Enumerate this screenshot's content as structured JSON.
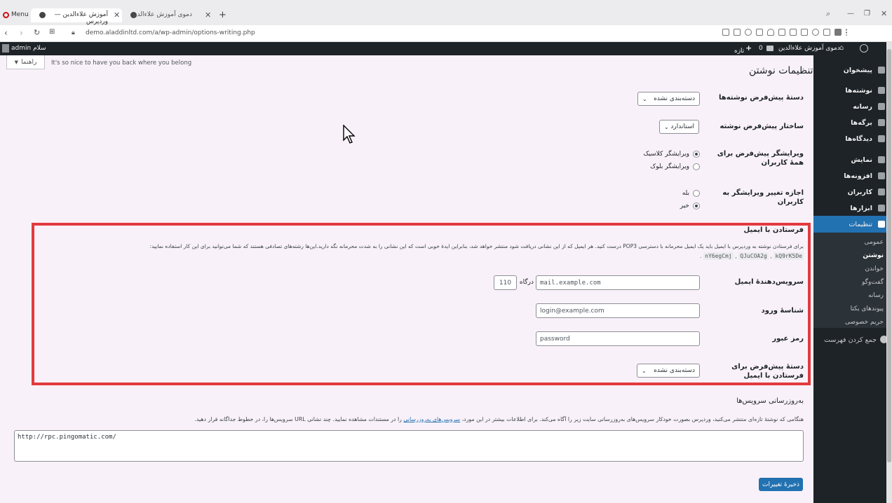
{
  "browser": {
    "menu_label": "Menu",
    "tabs": [
      {
        "title": "آموزش علاءالدین — وردپرس",
        "active": true
      },
      {
        "title": "دموی آموزش علاءالدین",
        "active": false
      }
    ],
    "new_tab": "+",
    "url": "demo.aladdinltd.com/a/wp-admin/options-writing.php"
  },
  "adminbar": {
    "site_name": "دموی آموزش علاءالدین",
    "comments_count": "0",
    "new_label": "تازه",
    "greeting": "سلام admin"
  },
  "sidebar": {
    "items": [
      {
        "label": "پیشخوان"
      },
      {
        "label": "نوشته‌ها"
      },
      {
        "label": "رسانه"
      },
      {
        "label": "برگه‌ها"
      },
      {
        "label": "دیدگاه‌ها"
      },
      {
        "label": "نمایش"
      },
      {
        "label": "افزونه‌ها"
      },
      {
        "label": "کاربران"
      },
      {
        "label": "ابزارها"
      },
      {
        "label": "تنظیمات"
      }
    ],
    "submenu": [
      "عمومی",
      "نوشتن",
      "خواندن",
      "گفت‌وگو",
      "رسانه",
      "پیوندهای یکتا",
      "حریم خصوصی"
    ],
    "collapse": "جمع کردن فهرست"
  },
  "header": {
    "hello_text": "It's so nice to have you back where you belong",
    "help_label": "راهنما",
    "title": "تنظیمات نوشتن"
  },
  "form": {
    "default_category_label": "دستهٔ پیش‌فرض نوشته‌ها",
    "default_category_value": "دسته‌بندی نشده",
    "default_format_label": "ساختار پیش‌فرض نوشته",
    "default_format_value": "استاندارد",
    "editor_label": "ویرایشگر پیش‌فرض برای همهٔ کاربران",
    "editor_options": [
      "ویرایشگر کلاسیک",
      "ویرایشگر بلوک"
    ],
    "allow_switch_label": "اجازه تغییر ویرایشگر به کاربران",
    "allow_switch_options": [
      "بله",
      "خیر"
    ]
  },
  "email_section": {
    "heading": "فرستادن با ایمیل",
    "description": "برای فرستادن نوشته به وردپرس با ایمیل باید یک ایمیل محرمانه با دسترسی POP3 درست کنید. هر ایمیل که از این نشانی دریافت شود منتشر خواهد شد، بنابراین ایدهٔ خوبی است که این نشانی را به شدت محرمانه نگه دارید.این‌ها رشته‌های تصادفی هستند که شما می‌توانید برای این کار استفاده نمایید:",
    "codes": [
      "kQ9rK5De",
      "QJuCOA2g",
      "nY6egCmj"
    ],
    "server_label": "سرویس‌دهندهٔ ایمیل",
    "server_value": "mail.example.com",
    "port_label": "درگاه",
    "port_value": "110",
    "login_label": "شناسهٔ ورود",
    "login_value": "login@example.com",
    "password_label": "رمز عبور",
    "password_value": "password",
    "category_label": "دستهٔ پیش‌فرض برای فرستادن با ایمیل",
    "category_value": "دسته‌بندی نشده"
  },
  "update_services": {
    "heading": "به‌روزرسانی سرویس‌ها",
    "description_before": "هنگامی که نوشتهٔ تازه‌ای منتشر می‌کنید، وردپرس بصورت خودکار سرویس‌های به‌روزرسانی سایت زیر را آگاه می‌کند. برای اطلاعات بیشتر در این مورد، ",
    "link_text": "سرویس‌های به‌روزرسانی",
    "description_after": " را در مستندات مشاهده نمایید. چند نشانی URL سرویس‌ها را، در خطوط جداگانه قرار دهید.",
    "services_value": "http://rpc.pingomatic.com/"
  },
  "save_label": "ذخیرهٔ تغییرات",
  "colors": {
    "accent": "#2271b1",
    "highlight_border": "#e23a3f",
    "admin_dark": "#1d2327",
    "content_bg": "#f9f1f9"
  }
}
